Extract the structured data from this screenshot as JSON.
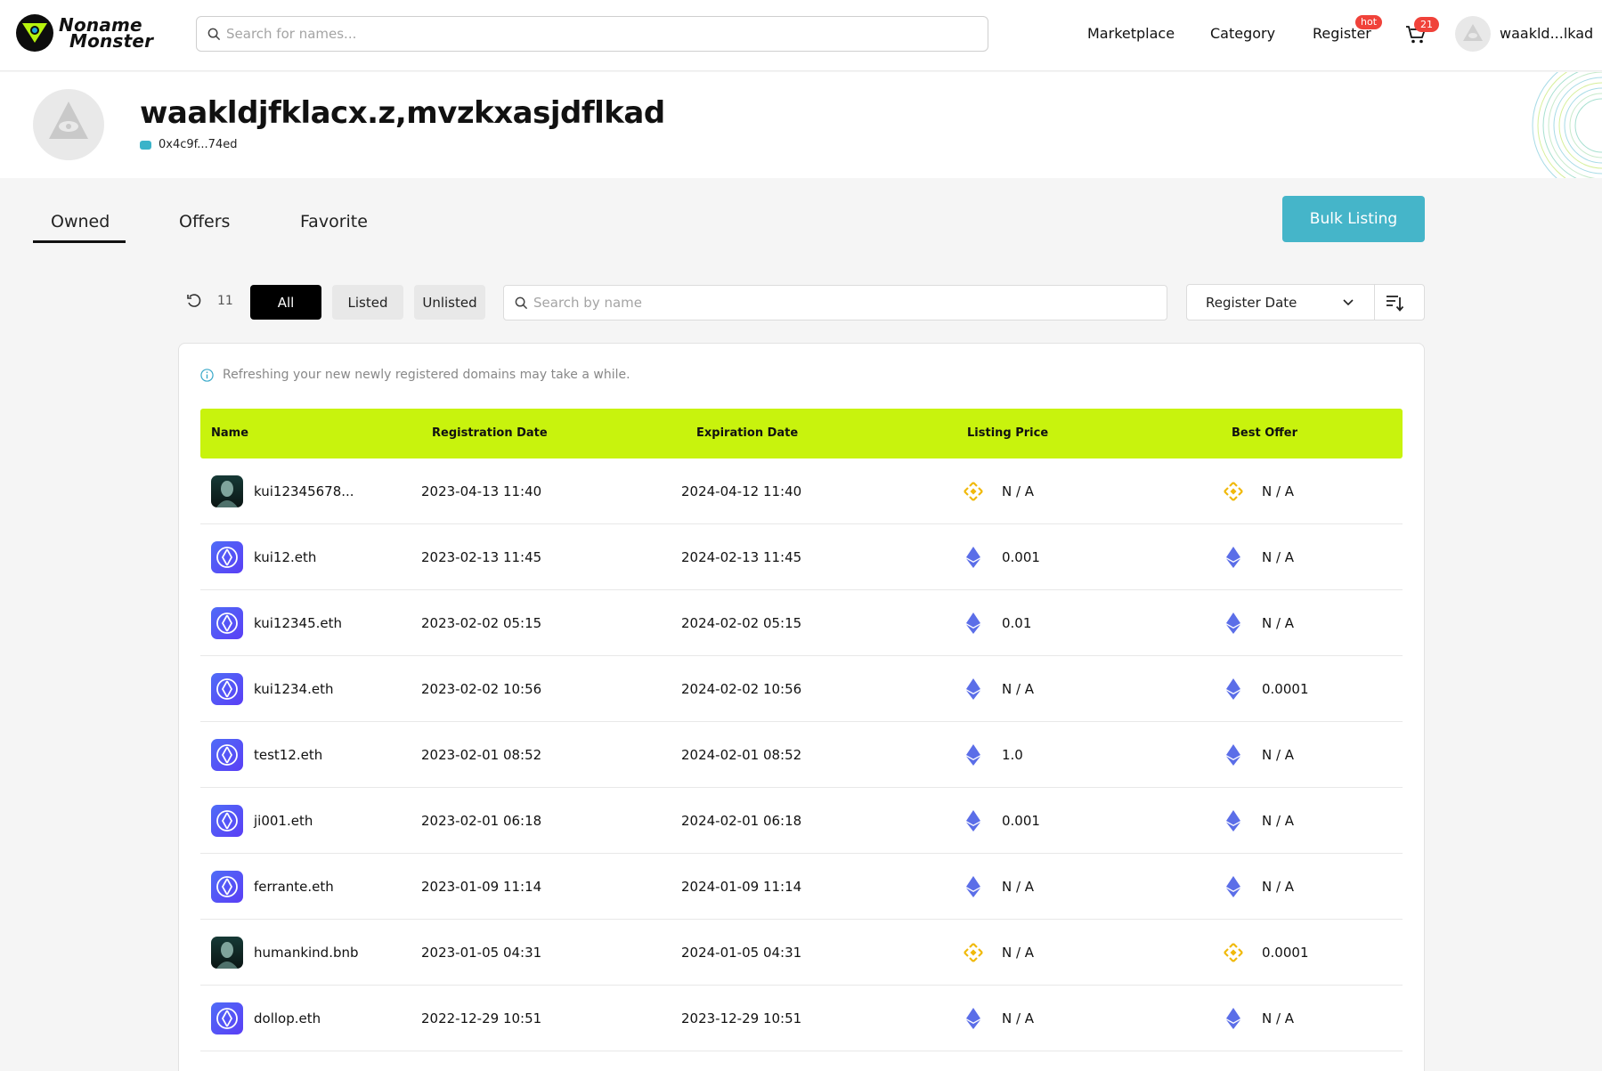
{
  "header": {
    "logo_line1": "Noname",
    "logo_line2": "Monster",
    "search_placeholder": "Search for names...",
    "nav": [
      "Marketplace",
      "Category",
      "Register"
    ],
    "hot_badge": "hot",
    "cart_count": "21",
    "user_short": "waakld...lkad"
  },
  "profile": {
    "name": "waakldjfklacx.z,mvzkxasjdflkad",
    "address": "0x4c9f...74ed"
  },
  "tabs": [
    "Owned",
    "Offers",
    "Favorite"
  ],
  "active_tab": "Owned",
  "bulk_listing_label": "Bulk Listing",
  "filters": {
    "count": "11",
    "all": "All",
    "listed": "Listed",
    "unlisted": "Unlisted",
    "search_placeholder": "Search by name",
    "sort_by": "Register Date"
  },
  "notice": "Refreshing your new newly registered domains may take a while.",
  "table": {
    "columns": [
      "Name",
      "Registration Date",
      "Expiration Date",
      "Listing Price",
      "Best Offer"
    ],
    "rows": [
      {
        "name": "kui12345678...",
        "chain": "bnb",
        "registered": "2023-04-13 11:40",
        "expires": "2024-04-12 11:40",
        "listing_price": "N / A",
        "best_offer": "N / A"
      },
      {
        "name": "kui12.eth",
        "chain": "eth",
        "registered": "2023-02-13 11:45",
        "expires": "2024-02-13 11:45",
        "listing_price": "0.001",
        "best_offer": "N / A"
      },
      {
        "name": "kui12345.eth",
        "chain": "eth",
        "registered": "2023-02-02 05:15",
        "expires": "2024-02-02 05:15",
        "listing_price": "0.01",
        "best_offer": "N / A"
      },
      {
        "name": "kui1234.eth",
        "chain": "eth",
        "registered": "2023-02-02 10:56",
        "expires": "2024-02-02 10:56",
        "listing_price": "N / A",
        "best_offer": "0.0001"
      },
      {
        "name": "test12.eth",
        "chain": "eth",
        "registered": "2023-02-01 08:52",
        "expires": "2024-02-01 08:52",
        "listing_price": "1.0",
        "best_offer": "N / A"
      },
      {
        "name": "ji001.eth",
        "chain": "eth",
        "registered": "2023-02-01 06:18",
        "expires": "2024-02-01 06:18",
        "listing_price": "0.001",
        "best_offer": "N / A"
      },
      {
        "name": "ferrante.eth",
        "chain": "eth",
        "registered": "2023-01-09 11:14",
        "expires": "2024-01-09 11:14",
        "listing_price": "N / A",
        "best_offer": "N / A"
      },
      {
        "name": "humankind.bnb",
        "chain": "bnb",
        "registered": "2023-01-05 04:31",
        "expires": "2024-01-05 04:31",
        "listing_price": "N / A",
        "best_offer": "0.0001"
      },
      {
        "name": "dollop.eth",
        "chain": "eth",
        "registered": "2022-12-29 10:51",
        "expires": "2023-12-29 10:51",
        "listing_price": "N / A",
        "best_offer": "N / A"
      }
    ]
  },
  "colors": {
    "accent_teal": "#45b5c9",
    "table_header": "#c8f30d",
    "hot_red": "#f0423a",
    "eth_blue": "#5b6ee8",
    "bnb_orange": "#f0b90b"
  }
}
